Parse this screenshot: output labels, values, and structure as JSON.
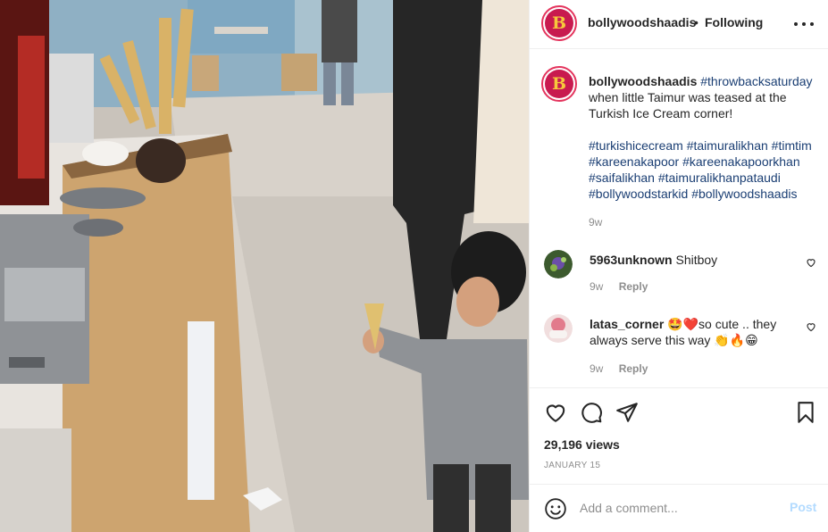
{
  "post": {
    "media_description_icon": "video-frame",
    "author": "bollywoodshaadis",
    "avatar_letter": "B",
    "follow_separator": "•",
    "follow_status": "Following"
  },
  "caption": {
    "username": "bollywoodshaadis",
    "first_tag": "#throwbacksaturday",
    "text": " when little Taimur was teased at the Turkish Ice Cream corner!",
    "tags": [
      "#turkishicecream",
      "#taimuralikhan",
      "#timtim",
      "#kareenakapoor",
      "#kareenakapoorkhan",
      "#saifalikhan",
      "#taimuralikhanpataudi",
      "#bollywoodstarkid",
      "#bollywoodshaadis"
    ],
    "age": "9w"
  },
  "comments": [
    {
      "username": "5963unknown",
      "text": "Shitboy",
      "age": "9w",
      "reply_label": "Reply"
    },
    {
      "username": "latas_corner",
      "text_line1": " 🤩❤️so cute .. they",
      "text_line2": "always serve this way 👏🔥😁",
      "age": "9w",
      "reply_label": "Reply"
    }
  ],
  "stats": {
    "views": "29,196 views",
    "date": "JANUARY 15"
  },
  "add_comment": {
    "placeholder": "Add a comment...",
    "post_label": "Post"
  },
  "colors": {
    "accent_link": "#1a3e73",
    "post_disabled": "#b3dbff",
    "avatar_bg": "#c81a4f",
    "avatar_letter": "#f6c83c",
    "meta_gray": "#8e8e8e"
  }
}
